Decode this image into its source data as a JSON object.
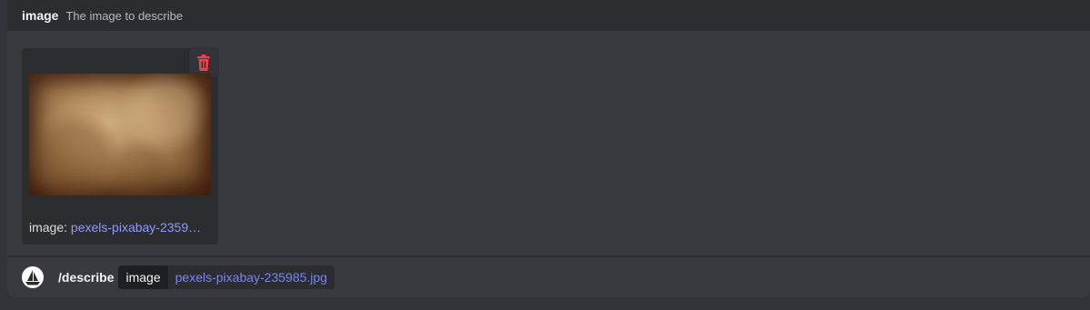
{
  "option_header": {
    "name": "image",
    "description": "The image to describe"
  },
  "attachment": {
    "caption_label": "image:",
    "caption_filename": "pexels-pixabay-2359…",
    "delete_icon": "trash-icon",
    "thumbnail": "parchment-texture"
  },
  "command_bar": {
    "avatar_icon": "bot-avatar-sailboat",
    "command": "/describe",
    "option_key": "image",
    "option_value": "pexels-pixabay-235985.jpg"
  },
  "colors": {
    "background": "#313338",
    "panel": "#383a40",
    "header": "#2b2d31",
    "danger": "#f23f43",
    "link": "#8e9cf7"
  }
}
